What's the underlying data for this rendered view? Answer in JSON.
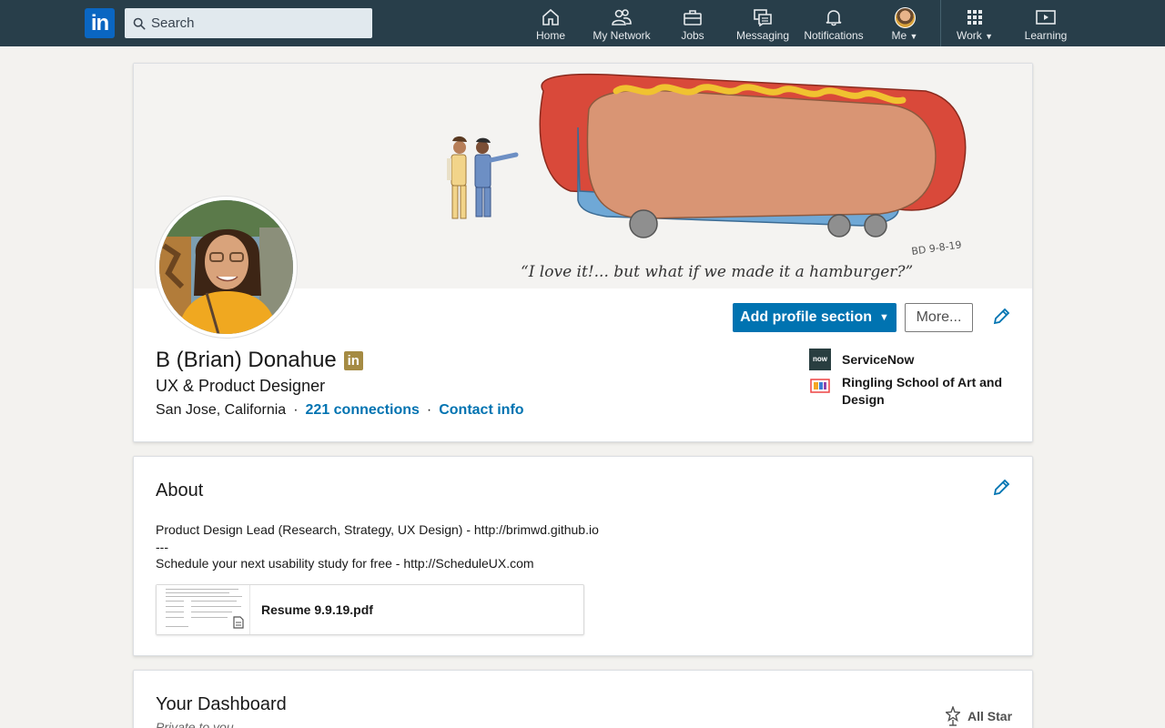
{
  "nav": {
    "search_placeholder": "Search",
    "items": [
      {
        "label": "Home",
        "icon": "home-icon"
      },
      {
        "label": "My Network",
        "icon": "network-icon"
      },
      {
        "label": "Jobs",
        "icon": "briefcase-icon"
      },
      {
        "label": "Messaging",
        "icon": "messaging-icon"
      },
      {
        "label": "Notifications",
        "icon": "bell-icon"
      },
      {
        "label": "Me",
        "icon": "avatar"
      },
      {
        "label": "Work",
        "icon": "grid-icon"
      },
      {
        "label": "Learning",
        "icon": "play-icon"
      }
    ]
  },
  "profile": {
    "banner_quote": "“I love it!... but what if we made it a hamburger?”",
    "banner_signature": "BD 9-8-19",
    "name": "B (Brian) Donahue",
    "headline": "UX & Product Designer",
    "location": "San Jose, California",
    "separator": "·",
    "connections": "221 connections",
    "contact_info": "Contact info",
    "add_section_label": "Add profile section",
    "more_label": "More...",
    "companies": [
      {
        "name": "ServiceNow",
        "logo_text": "now"
      },
      {
        "name": "Ringling School of Art and Design"
      }
    ]
  },
  "about": {
    "title": "About",
    "text": "Product Design Lead (Research, Strategy, UX Design) - http://brimwd.github.io\n---\nSchedule your next usability study for free - http://ScheduleUX.com",
    "document_name": "Resume 9.9.19.pdf"
  },
  "dashboard": {
    "title": "Your Dashboard",
    "subtitle": "Private to you",
    "badge_label": "All Star"
  },
  "colors": {
    "nav_bg": "#283e4a",
    "primary": "#0073b1",
    "page_bg": "#f3f2ef",
    "premium_gold": "#a58b43"
  }
}
